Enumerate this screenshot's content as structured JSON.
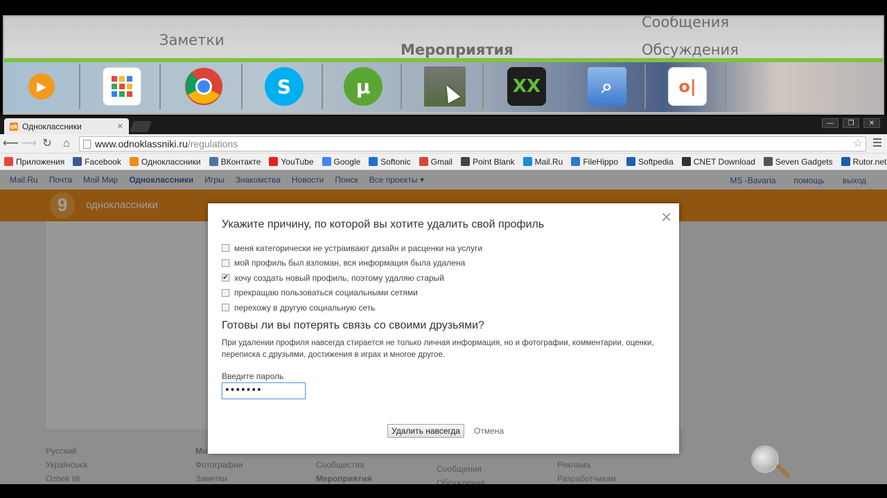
{
  "dock": {
    "ghost_items": [
      "Заметки",
      "Мероприятия",
      "Сообщения",
      "Обсуждения"
    ],
    "apps": [
      {
        "icon": "media-player-icon",
        "color": "#f39a1d",
        "glyph": "▶"
      },
      {
        "icon": "apps-grid-icon",
        "color": "#ffffff",
        "glyph": ""
      },
      {
        "icon": "chrome-icon",
        "color": "#db4437",
        "glyph": ""
      },
      {
        "icon": "skype-icon",
        "color": "#00aff0",
        "glyph": "S"
      },
      {
        "icon": "utorrent-icon",
        "color": "#5aa635",
        "glyph": "µ"
      },
      {
        "icon": "game-screenshot-icon",
        "color": "#6b7b55",
        "glyph": ""
      },
      {
        "icon": "xx-app-icon",
        "color": "#1e1e1e",
        "glyph": "XX"
      },
      {
        "icon": "network-search-icon",
        "color": "#3f7bd1",
        "glyph": ""
      },
      {
        "icon": "office-icon",
        "color": "#e86a3a",
        "glyph": "o|"
      }
    ]
  },
  "browser": {
    "tab_title": "Одноклассники",
    "url_domain": "www.odnoklassniki.ru",
    "url_path": "/regulations",
    "bookmarks": [
      {
        "label": "Приложения",
        "icon": "apps-icon",
        "color": "#e8453c"
      },
      {
        "label": "Facebook",
        "icon": "facebook-icon",
        "color": "#3b5998"
      },
      {
        "label": "Одноклассники",
        "icon": "odnoklassniki-icon",
        "color": "#f2891d"
      },
      {
        "label": "ВКонтакте",
        "icon": "vkontakte-icon",
        "color": "#4c75a3"
      },
      {
        "label": "YouTube",
        "icon": "youtube-icon",
        "color": "#e62117"
      },
      {
        "label": "Google",
        "icon": "google-icon",
        "color": "#4285f4"
      },
      {
        "label": "Softonic",
        "icon": "softonic-icon",
        "color": "#1f6fd1"
      },
      {
        "label": "Gmail",
        "icon": "gmail-icon",
        "color": "#d44638"
      },
      {
        "label": "Point Blank",
        "icon": "pointblank-icon",
        "color": "#444444"
      },
      {
        "label": "Mail.Ru",
        "icon": "mailru-icon",
        "color": "#168de2"
      },
      {
        "label": "FileHippo",
        "icon": "filehippo-icon",
        "color": "#2a7ad2"
      },
      {
        "label": "Softpedia",
        "icon": "softpedia-icon",
        "color": "#2060b0"
      },
      {
        "label": "CNET Download",
        "icon": "cnet-icon",
        "color": "#333333"
      },
      {
        "label": "Seven Gadgets",
        "icon": "sevengadgets-icon",
        "color": "#555555"
      },
      {
        "label": "Rutor.net",
        "icon": "rutor-icon",
        "color": "#1c5db0"
      }
    ]
  },
  "portal": {
    "links": [
      "Mail.Ru",
      "Почта",
      "Мой Мир",
      "Одноклассники",
      "Игры",
      "Знакомства",
      "Новости",
      "Поиск",
      "Все проекты ▾"
    ],
    "active": "Одноклассники",
    "user": "MS -Bavaria",
    "help": "помощь",
    "logout": "выход"
  },
  "site": {
    "logo_text": "одноклассники"
  },
  "footer": {
    "col1": [
      "Русский",
      "Українська",
      "Ozbek tili"
    ],
    "col2": [
      "Мо",
      "Фотографии",
      "Заметки"
    ],
    "col3": [
      "Сообщества",
      "Мероприятия"
    ],
    "col4": [
      "Сообщения",
      "Обсуждения"
    ],
    "col5": [
      "Реклама",
      "Разработчикам"
    ]
  },
  "dialog": {
    "title": "Укажите причину, по которой вы хотите удалить свой профиль",
    "options": [
      {
        "label": "меня категорически не устраивают дизайн и расценки на услуги",
        "checked": false
      },
      {
        "label": "мой профиль был взломан, вся информация была удалена",
        "checked": false
      },
      {
        "label": "хочу создать новый профиль, поэтому удаляю старый",
        "checked": true
      },
      {
        "label": "прекращаю пользоваться социальными сетями",
        "checked": false
      },
      {
        "label": "перехожу в другую социальную сеть",
        "checked": false
      }
    ],
    "question": "Готовы ли вы потерять связь со своими друзьями?",
    "warning": "При удалении профиля навсегда стирается не только личная информация, но и фотографии, комментарии, оценки, переписка с друзьями, достижения в играх и многое другое.",
    "password_label": "Введите пароль",
    "password_value": "•••••••",
    "delete_button": "Удалить навсегда",
    "cancel_link": "Отмена"
  }
}
